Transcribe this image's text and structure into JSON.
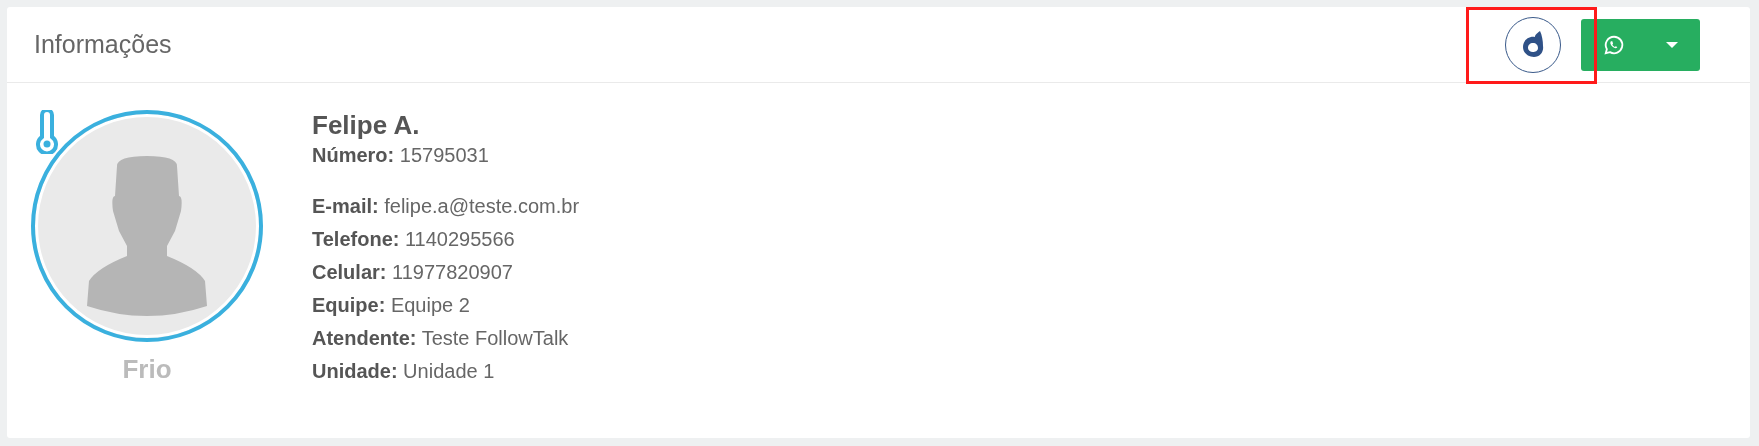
{
  "panel": {
    "title": "Informações"
  },
  "header_actions": {
    "brand_logo": {
      "highlighted": true
    }
  },
  "contact": {
    "temperature": "Frio",
    "name": "Felipe A.",
    "number": {
      "label": "Número:",
      "value": "15795031"
    },
    "fields": [
      {
        "label": "E-mail:",
        "value": "felipe.a@teste.com.br"
      },
      {
        "label": "Telefone:",
        "value": "1140295566"
      },
      {
        "label": "Celular:",
        "value": "11977820907"
      },
      {
        "label": "Equipe:",
        "value": "Equipe 2"
      },
      {
        "label": "Atendente:",
        "value": "Teste FollowTalk"
      },
      {
        "label": "Unidade:",
        "value": "Unidade 1"
      }
    ]
  }
}
